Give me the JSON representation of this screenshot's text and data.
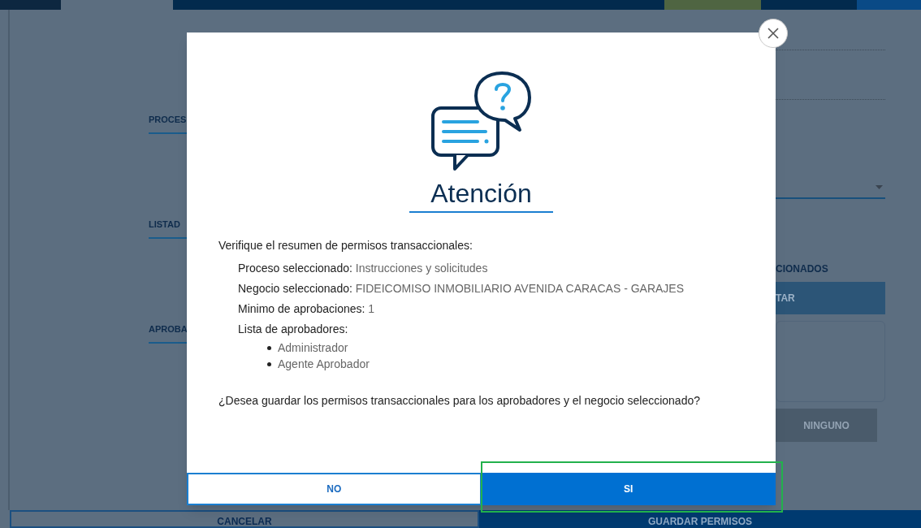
{
  "background": {
    "sections": [
      {
        "label": "PROCES"
      },
      {
        "label": "LISTAD"
      },
      {
        "label": "APROBA"
      }
    ],
    "right_panel": {
      "heading": "CIONADOS",
      "select_button": "TAR",
      "clear_button": "NINGUNO"
    },
    "footer_buttons": [
      {
        "label": "CANCELAR",
        "kind": "secondary"
      },
      {
        "label": "GUARDAR PERMISOS",
        "kind": "primary"
      }
    ]
  },
  "dialog": {
    "title": "Atención",
    "intro": "Verifique el resumen de permisos transaccionales:",
    "details": [
      {
        "label": "Proceso seleccionado:",
        "value": "Instrucciones y solicitudes"
      },
      {
        "label": "Negocio seleccionado:",
        "value": "FIDEICOMISO INMOBILIARIO AVENIDA CARACAS - GARAJES"
      },
      {
        "label": "Minimo de aprobaciones:",
        "value": "1"
      },
      {
        "label": "Lista de aprobadores:",
        "items": [
          "Administrador",
          "Agente Aprobador"
        ]
      }
    ],
    "question": "¿Desea guardar los permisos transaccionales para los aprobadores y el negocio seleccionado?",
    "buttons": [
      {
        "label": "NO",
        "kind": "secondary",
        "highlighted": false
      },
      {
        "label": "SI",
        "kind": "primary",
        "highlighted": true
      }
    ]
  }
}
